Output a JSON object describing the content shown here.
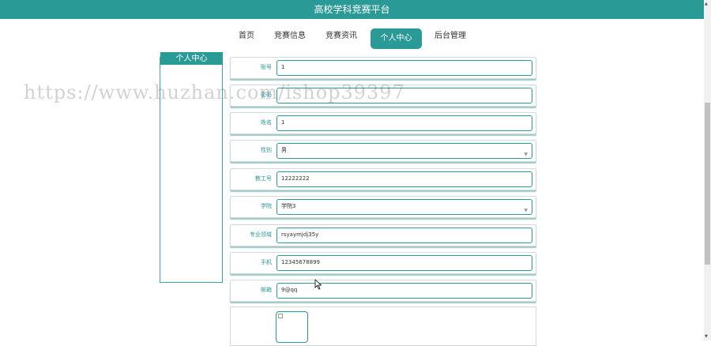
{
  "header": {
    "title": "高校学科竞赛平台"
  },
  "nav": {
    "items": [
      "首页",
      "竞赛信息",
      "竞赛资讯",
      "个人中心",
      "后台管理"
    ],
    "active_index": 3
  },
  "sidebar": {
    "title": "个人中心"
  },
  "form": {
    "account": {
      "label": "账号",
      "value": "1"
    },
    "password": {
      "label": "密码",
      "value": ""
    },
    "name": {
      "label": "姓名",
      "value": "1"
    },
    "gender": {
      "label": "性别",
      "value": "男"
    },
    "staff_id": {
      "label": "教工号",
      "value": "12222222"
    },
    "college": {
      "label": "学院",
      "value": "学院3"
    },
    "field": {
      "label": "专业领域",
      "value": "rsyaymjdj35y"
    },
    "phone": {
      "label": "手机",
      "value": "12345678899"
    },
    "email": {
      "label": "邮箱",
      "value": "9@qq"
    }
  },
  "watermark": "https://www.huzhan.com/ishop39397",
  "colors": {
    "primary": "#2a9a97"
  }
}
